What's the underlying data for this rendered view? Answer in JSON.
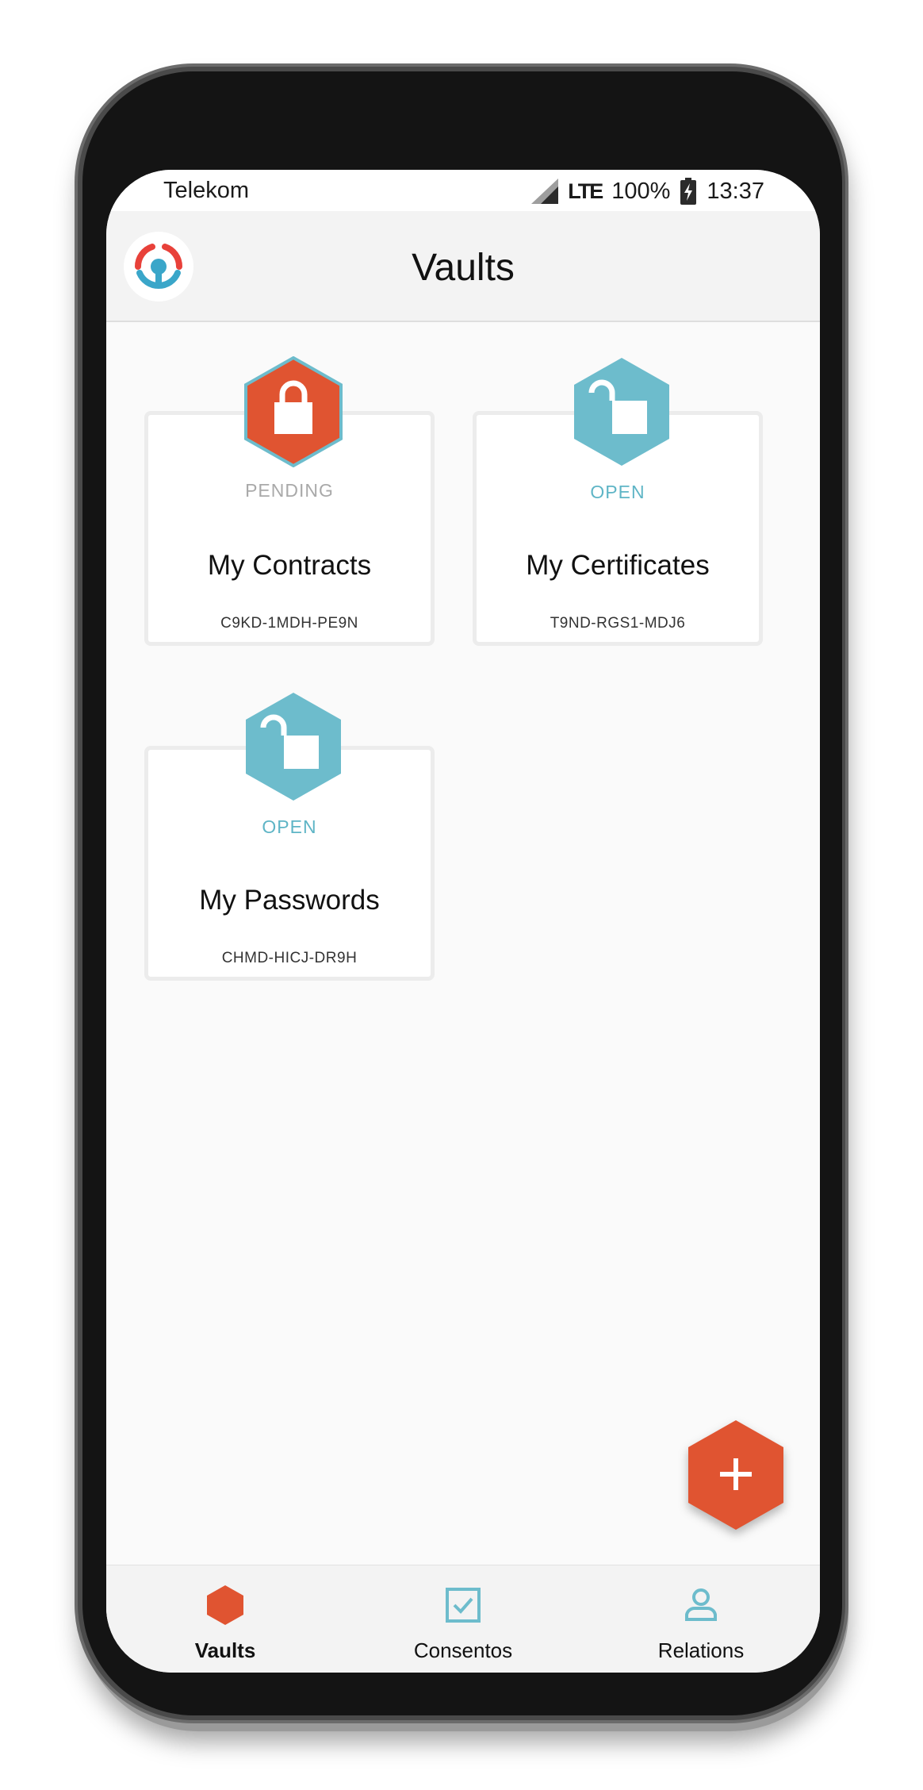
{
  "status_bar": {
    "carrier": "Telekom",
    "network": "LTE",
    "battery": "100%",
    "time": "13:37"
  },
  "header": {
    "title": "Vaults",
    "logo_icon": "app-logo-icon"
  },
  "vaults": [
    {
      "status": "PENDING",
      "name": "My Contracts",
      "code": "C9KD-1MDH-PE9N",
      "icon": "lock-closed-icon",
      "hex_color": "#e05431",
      "status_color": "#a9a9a9"
    },
    {
      "status": "OPEN",
      "name": "My Certificates",
      "code": "T9ND-RGS1-MDJ6",
      "icon": "lock-open-icon",
      "hex_color": "#6dbccc",
      "status_color": "#5fb5c6"
    },
    {
      "status": "OPEN",
      "name": "My Passwords",
      "code": "CHMD-HICJ-DR9H",
      "icon": "lock-open-icon",
      "hex_color": "#6dbccc",
      "status_color": "#5fb5c6"
    }
  ],
  "fab": {
    "icon": "plus-icon",
    "color": "#e05431"
  },
  "bottom_nav": {
    "items": [
      {
        "label": "Vaults",
        "icon": "hexagon-icon",
        "active": true
      },
      {
        "label": "Consentos",
        "icon": "checkbox-icon",
        "active": false
      },
      {
        "label": "Relations",
        "icon": "person-icon",
        "active": false
      }
    ]
  },
  "colors": {
    "accent_orange": "#e05431",
    "accent_teal": "#6dbccc",
    "logo_red": "#e8413a",
    "logo_blue": "#3aa6c9"
  }
}
